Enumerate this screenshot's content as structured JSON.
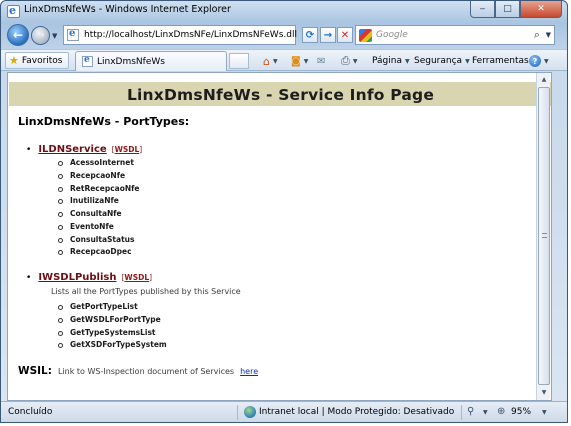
{
  "window": {
    "title": "LinxDmsNfeWs - Windows Internet Explorer",
    "minimize_glyph": "‒",
    "maximize_glyph": "□",
    "close_glyph": "✕"
  },
  "navigation": {
    "address": "http://localhost/LinxDmsNFe/LinxDmsNFeWs.dll",
    "search_placeholder": "Google",
    "icons": [
      "back-icon",
      "forward-icon",
      "refresh-icon",
      "go-icon",
      "stop-icon",
      "search-icon"
    ]
  },
  "favorites_bar": {
    "favorites_label": "Favoritos",
    "tab_label": "LinxDmsNfeWs"
  },
  "command_bar": {
    "page_label": "Página",
    "safety_label": "Segurança",
    "tools_label": "Ferramentas",
    "help_glyph": "?"
  },
  "page": {
    "banner_title": "LinxDmsNfeWs - Service Info Page",
    "heading": "LinxDmsNfeWs - PortTypes:",
    "wsdl_label": "WSDL",
    "services": [
      {
        "name": "ILDNService",
        "operations": [
          "AcessoInternet",
          "RecepcaoNfe",
          "RetRecepcaoNfe",
          "InutilizaNfe",
          "ConsultaNfe",
          "EventoNfe",
          "ConsultaStatus",
          "RecepcaoDpec"
        ]
      },
      {
        "name": "IWSDLPublish",
        "description": "Lists all the PortTypes published by this Service",
        "operations": [
          "GetPortTypeList",
          "GetWSDLForPortType",
          "GetTypeSystemsList",
          "GetXSDForTypeSystem"
        ]
      }
    ],
    "wsil_label": "WSIL:",
    "wsil_text": "Link to WS-Inspection document of Services",
    "wsil_link": "here"
  },
  "status_bar": {
    "status": "Concluído",
    "zone": "Intranet local | Modo Protegido: Desativado",
    "zoom": "95%"
  }
}
